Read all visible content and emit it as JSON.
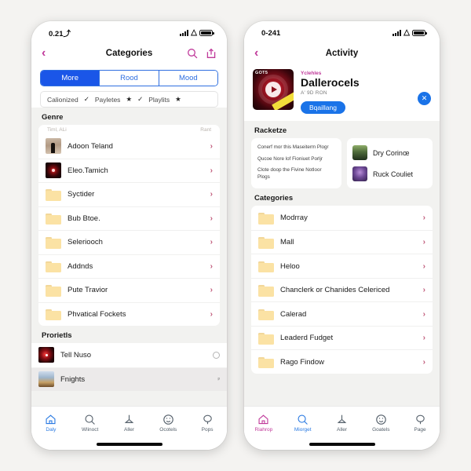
{
  "left_phone": {
    "status": {
      "time": "0.21⤴",
      "wifi_icon": "wifi-icon",
      "signal_icon": "cellular-signal-icon",
      "battery_icon": "battery-icon"
    },
    "nav": {
      "back_icon": "chevron-left-icon",
      "title": "Categories",
      "search_icon": "search-icon",
      "share_icon": "share-upload-icon"
    },
    "segmented": {
      "options": [
        "More",
        "Rood",
        "Mood"
      ],
      "selected": "More"
    },
    "filterbar": {
      "items": [
        "Calionized",
        "✓",
        "Payletes",
        "★",
        "✓",
        "Playlits",
        "★"
      ]
    },
    "genre_section": {
      "title": "Genre",
      "subheader_left": "Timl, ALi",
      "subheader_right": "Rant",
      "rows": [
        {
          "label": "Adoon Teland",
          "icon": "album-art-person",
          "chevron": "chevron-right-icon"
        },
        {
          "label": "Eleo.Tamich",
          "icon": "album-art-vinyl",
          "chevron": "chevron-right-icon"
        },
        {
          "label": "Syctider",
          "icon": "folder-icon",
          "chevron": "chevron-right-icon"
        },
        {
          "label": "Bub Btoe.",
          "icon": "folder-icon",
          "chevron": "chevron-right-icon"
        },
        {
          "label": "Seleriooch",
          "icon": "folder-icon",
          "chevron": "chevron-right-icon"
        },
        {
          "label": "Addnds",
          "icon": "folder-icon",
          "chevron": "chevron-right-icon"
        },
        {
          "label": "Pute Travior",
          "icon": "folder-icon",
          "chevron": "chevron-right-icon"
        },
        {
          "label": "Phvatical Fockets",
          "icon": "folder-icon",
          "chevron": "chevron-right-icon"
        }
      ]
    },
    "proriet_section": {
      "title": "Prorietls",
      "rows": [
        {
          "label": "Tell Nuso",
          "icon": "album-art-disc",
          "trailing": "radio-unselected",
          "selected": false
        },
        {
          "label": "Fnights",
          "icon": "album-art-city",
          "trailing": "ᵖ",
          "selected": true
        }
      ]
    },
    "tabs": [
      {
        "label": "Daly",
        "icon": "home-icon",
        "state": "active-blue"
      },
      {
        "label": "Wlinoct",
        "icon": "search-icon",
        "state": "inactive"
      },
      {
        "label": "Aller",
        "icon": "lamp-icon",
        "state": "inactive"
      },
      {
        "label": "Ocotels",
        "icon": "smiley-face-icon",
        "state": "inactive"
      },
      {
        "label": "Pops",
        "icon": "balloon-icon",
        "state": "inactive"
      }
    ]
  },
  "right_phone": {
    "status": {
      "time": "0-241",
      "wifi_icon": "wifi-icon",
      "signal_icon": "cellular-signal-icon",
      "battery_icon": "battery-icon"
    },
    "nav": {
      "back_icon": "chevron-left-icon",
      "title": "Activity"
    },
    "banner": {
      "art_badge": "GOT5",
      "art_icon": "play-circle-icon",
      "kicker": "Yclehles",
      "title": "Dallerocels",
      "subtitle": "A' 9D RON",
      "cta_label": "Bqaillang",
      "close_icon": "close-icon"
    },
    "racketze_section": {
      "title": "Racketze",
      "left_card_lines": [
        "Conerf mor this Maseiterm Plogr",
        "Qucoe Nore lof Fioniuet Porljr",
        "Clote doop the Fivine Notloor Plogs"
      ],
      "right_card_rows": [
        {
          "label": "Dry Corinœ",
          "icon": "album-art-landscape"
        },
        {
          "label": "Ruck Couliet",
          "icon": "album-art-purple"
        }
      ]
    },
    "categories_section": {
      "title": "Categories",
      "rows": [
        {
          "label": "Modrray",
          "icon": "folder-icon",
          "chevron": "chevron-right-icon"
        },
        {
          "label": "Mall",
          "icon": "folder-icon",
          "chevron": "chevron-right-icon"
        },
        {
          "label": "Heloo",
          "icon": "folder-icon",
          "chevron": "chevron-right-icon"
        },
        {
          "label": "Chanclerk or Chanides Celericed",
          "icon": "folder-icon",
          "chevron": "chevron-right-icon"
        },
        {
          "label": "Calerad",
          "icon": "folder-icon",
          "chevron": "chevron-right-icon"
        },
        {
          "label": "Leaderd Fudget",
          "icon": "folder-icon",
          "chevron": "chevron-right-icon"
        },
        {
          "label": "Rago Findow",
          "icon": "folder-icon",
          "chevron": "chevron-right-icon"
        }
      ]
    },
    "tabs": [
      {
        "label": "Riahrop",
        "icon": "home-icon",
        "state": "active-pink"
      },
      {
        "label": "Miorget",
        "icon": "search-icon",
        "state": "active-blue"
      },
      {
        "label": "Aller",
        "icon": "lamp-icon",
        "state": "inactive"
      },
      {
        "label": "Goatels",
        "icon": "smiley-face-icon",
        "state": "inactive"
      },
      {
        "label": "Page",
        "icon": "balloon-icon",
        "state": "inactive"
      }
    ]
  },
  "colors": {
    "accent_blue": "#1a56e8",
    "accent_pink": "#c0399a",
    "chevron_pink": "#c05a7a",
    "folder_yellow": "#fbe2a4",
    "page_bg": "#f4f3f1"
  }
}
